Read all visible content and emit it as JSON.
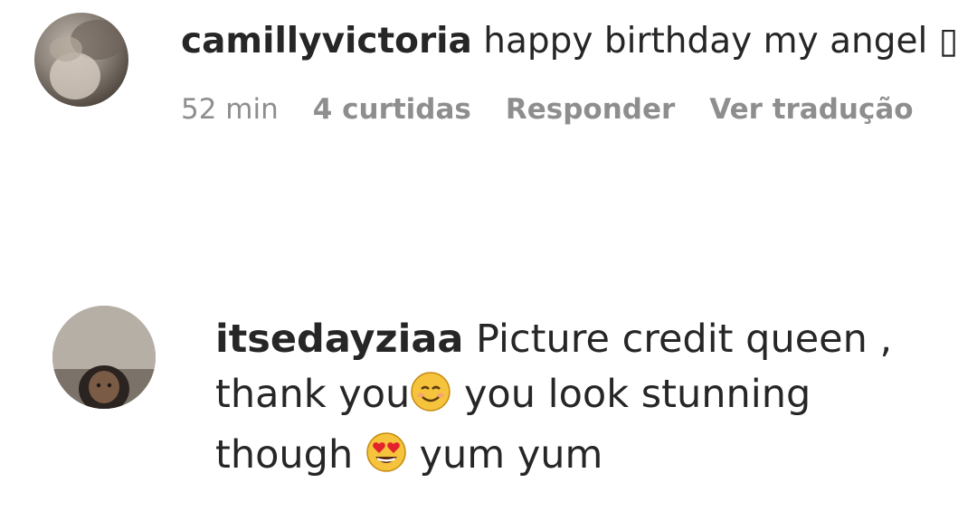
{
  "comments": [
    {
      "username": "camillyvictoria",
      "text": "happy birthday my angel ▯",
      "time": "52 min",
      "likes": "4 curtidas",
      "reply": "Responder",
      "translate": "Ver tradução"
    },
    {
      "username": "itsedayziaa",
      "text_part1": "Picture credit queen , thank you",
      "emoji1": "smiling-face-icon",
      "text_part2": " you look stunning though ",
      "emoji2": "heart-eyes-face-icon",
      "text_part3": " yum yum"
    }
  ]
}
